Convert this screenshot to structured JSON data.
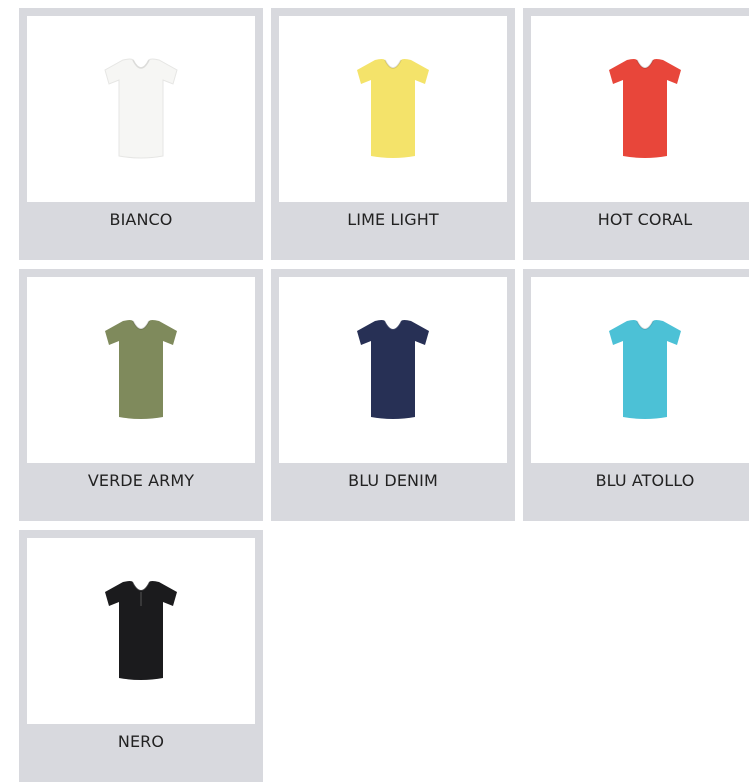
{
  "products": [
    {
      "name": "BIANCO",
      "color": "#f6f6f4",
      "icon": "t-shirt-icon"
    },
    {
      "name": "LIME LIGHT",
      "color": "#f4e36a",
      "icon": "t-shirt-icon"
    },
    {
      "name": "HOT CORAL",
      "color": "#e8463a",
      "icon": "t-shirt-icon"
    },
    {
      "name": "VERDE ARMY",
      "color": "#7f8a5c",
      "icon": "t-shirt-icon"
    },
    {
      "name": "BLU DENIM",
      "color": "#273055",
      "icon": "t-shirt-icon"
    },
    {
      "name": "BLU ATOLLO",
      "color": "#4cc1d6",
      "icon": "t-shirt-icon"
    },
    {
      "name": "NERO",
      "color": "#1b1b1d",
      "icon": "t-shirt-icon"
    }
  ]
}
